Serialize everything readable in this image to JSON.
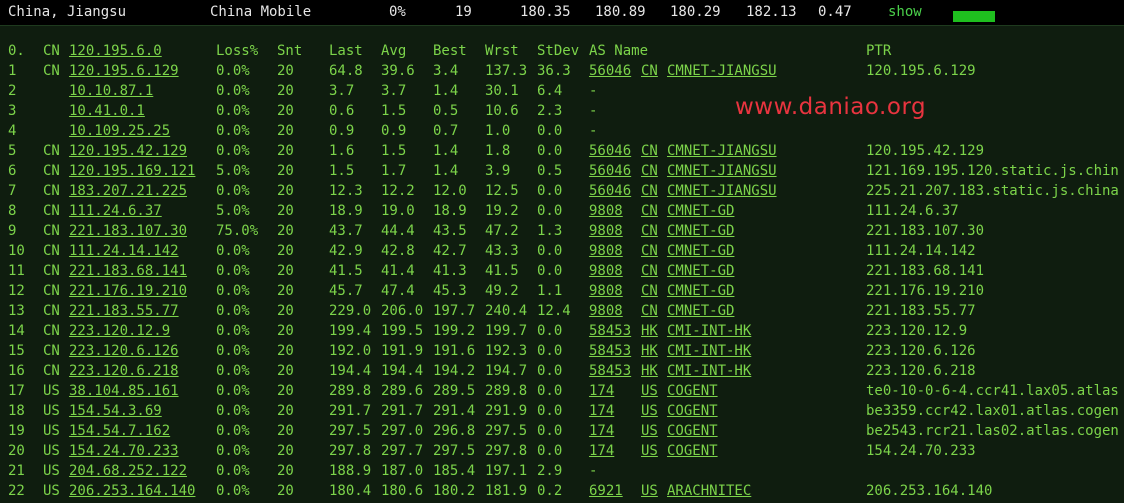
{
  "summary": {
    "location": "China, Jiangsu",
    "isp": "China Mobile",
    "loss": "0%",
    "sent": "19",
    "last": "180.35",
    "avg": "180.89",
    "best": "180.29",
    "worst": "182.13",
    "stdev": "0.47",
    "show_label": "show",
    "bar_color": "#1fbf1f"
  },
  "watermark": "www.daniao.org",
  "columns": {
    "hop": "0.",
    "cc": "CN",
    "ip": "120.195.6.0",
    "loss": "Loss%",
    "snt": "Snt",
    "last": "Last",
    "avg": "Avg",
    "best": "Best",
    "wrst": "Wrst",
    "stdev": "StDev",
    "asname": "AS Name",
    "ptr": "PTR"
  },
  "rows": [
    {
      "hop": "1",
      "cc": "CN",
      "ip": "120.195.6.129",
      "loss": "0.0%",
      "snt": "20",
      "last": "64.8",
      "avg": "39.6",
      "best": "3.4",
      "wrst": "137.3",
      "stdev": "36.3",
      "asn": "56046",
      "ascc": "CN",
      "asname": "CMNET-JIANGSU",
      "ptr": "120.195.6.129"
    },
    {
      "hop": "2",
      "cc": "",
      "ip": "10.10.87.1",
      "loss": "0.0%",
      "snt": "20",
      "last": "3.7",
      "avg": "3.7",
      "best": "1.4",
      "wrst": "30.1",
      "stdev": "6.4",
      "asn": "-",
      "ascc": "",
      "asname": "",
      "ptr": ""
    },
    {
      "hop": "3",
      "cc": "",
      "ip": "10.41.0.1",
      "loss": "0.0%",
      "snt": "20",
      "last": "0.6",
      "avg": "1.5",
      "best": "0.5",
      "wrst": "10.6",
      "stdev": "2.3",
      "asn": "-",
      "ascc": "",
      "asname": "",
      "ptr": ""
    },
    {
      "hop": "4",
      "cc": "",
      "ip": "10.109.25.25",
      "loss": "0.0%",
      "snt": "20",
      "last": "0.9",
      "avg": "0.9",
      "best": "0.7",
      "wrst": "1.0",
      "stdev": "0.0",
      "asn": "-",
      "ascc": "",
      "asname": "",
      "ptr": ""
    },
    {
      "hop": "5",
      "cc": "CN",
      "ip": "120.195.42.129",
      "loss": "0.0%",
      "snt": "20",
      "last": "1.6",
      "avg": "1.5",
      "best": "1.4",
      "wrst": "1.8",
      "stdev": "0.0",
      "asn": "56046",
      "ascc": "CN",
      "asname": "CMNET-JIANGSU",
      "ptr": "120.195.42.129"
    },
    {
      "hop": "6",
      "cc": "CN",
      "ip": "120.195.169.121",
      "loss": "5.0%",
      "snt": "20",
      "last": "1.5",
      "avg": "1.7",
      "best": "1.4",
      "wrst": "3.9",
      "stdev": "0.5",
      "asn": "56046",
      "ascc": "CN",
      "asname": "CMNET-JIANGSU",
      "ptr": "121.169.195.120.static.js.chin"
    },
    {
      "hop": "7",
      "cc": "CN",
      "ip": "183.207.21.225",
      "loss": "0.0%",
      "snt": "20",
      "last": "12.3",
      "avg": "12.2",
      "best": "12.0",
      "wrst": "12.5",
      "stdev": "0.0",
      "asn": "56046",
      "ascc": "CN",
      "asname": "CMNET-JIANGSU",
      "ptr": "225.21.207.183.static.js.china"
    },
    {
      "hop": "8",
      "cc": "CN",
      "ip": "111.24.6.37",
      "loss": "5.0%",
      "snt": "20",
      "last": "18.9",
      "avg": "19.0",
      "best": "18.9",
      "wrst": "19.2",
      "stdev": "0.0",
      "asn": "9808",
      "ascc": "CN",
      "asname": "CMNET-GD",
      "ptr": "111.24.6.37"
    },
    {
      "hop": "9",
      "cc": "CN",
      "ip": "221.183.107.30",
      "loss": "75.0%",
      "snt": "20",
      "last": "43.7",
      "avg": "44.4",
      "best": "43.5",
      "wrst": "47.2",
      "stdev": "1.3",
      "asn": "9808",
      "ascc": "CN",
      "asname": "CMNET-GD",
      "ptr": "221.183.107.30"
    },
    {
      "hop": "10",
      "cc": "CN",
      "ip": "111.24.14.142",
      "loss": "0.0%",
      "snt": "20",
      "last": "42.9",
      "avg": "42.8",
      "best": "42.7",
      "wrst": "43.3",
      "stdev": "0.0",
      "asn": "9808",
      "ascc": "CN",
      "asname": "CMNET-GD",
      "ptr": "111.24.14.142"
    },
    {
      "hop": "11",
      "cc": "CN",
      "ip": "221.183.68.141",
      "loss": "0.0%",
      "snt": "20",
      "last": "41.5",
      "avg": "41.4",
      "best": "41.3",
      "wrst": "41.5",
      "stdev": "0.0",
      "asn": "9808",
      "ascc": "CN",
      "asname": "CMNET-GD",
      "ptr": "221.183.68.141"
    },
    {
      "hop": "12",
      "cc": "CN",
      "ip": "221.176.19.210",
      "loss": "0.0%",
      "snt": "20",
      "last": "45.7",
      "avg": "47.4",
      "best": "45.3",
      "wrst": "49.2",
      "stdev": "1.1",
      "asn": "9808",
      "ascc": "CN",
      "asname": "CMNET-GD",
      "ptr": "221.176.19.210"
    },
    {
      "hop": "13",
      "cc": "CN",
      "ip": "221.183.55.77",
      "loss": "0.0%",
      "snt": "20",
      "last": "229.0",
      "avg": "206.0",
      "best": "197.7",
      "wrst": "240.4",
      "stdev": "12.4",
      "asn": "9808",
      "ascc": "CN",
      "asname": "CMNET-GD",
      "ptr": "221.183.55.77"
    },
    {
      "hop": "14",
      "cc": "CN",
      "ip": "223.120.12.9",
      "loss": "0.0%",
      "snt": "20",
      "last": "199.4",
      "avg": "199.5",
      "best": "199.2",
      "wrst": "199.7",
      "stdev": "0.0",
      "asn": "58453",
      "ascc": "HK",
      "asname": "CMI-INT-HK",
      "ptr": "223.120.12.9"
    },
    {
      "hop": "15",
      "cc": "CN",
      "ip": "223.120.6.126",
      "loss": "0.0%",
      "snt": "20",
      "last": "192.0",
      "avg": "191.9",
      "best": "191.6",
      "wrst": "192.3",
      "stdev": "0.0",
      "asn": "58453",
      "ascc": "HK",
      "asname": "CMI-INT-HK",
      "ptr": "223.120.6.126"
    },
    {
      "hop": "16",
      "cc": "CN",
      "ip": "223.120.6.218",
      "loss": "0.0%",
      "snt": "20",
      "last": "194.4",
      "avg": "194.4",
      "best": "194.2",
      "wrst": "194.7",
      "stdev": "0.0",
      "asn": "58453",
      "ascc": "HK",
      "asname": "CMI-INT-HK",
      "ptr": "223.120.6.218"
    },
    {
      "hop": "17",
      "cc": "US",
      "ip": "38.104.85.161",
      "loss": "0.0%",
      "snt": "20",
      "last": "289.8",
      "avg": "289.6",
      "best": "289.5",
      "wrst": "289.8",
      "stdev": "0.0",
      "asn": "174",
      "ascc": "US",
      "asname": "COGENT",
      "ptr": "te0-10-0-6-4.ccr41.lax05.atlas"
    },
    {
      "hop": "18",
      "cc": "US",
      "ip": "154.54.3.69",
      "loss": "0.0%",
      "snt": "20",
      "last": "291.7",
      "avg": "291.7",
      "best": "291.4",
      "wrst": "291.9",
      "stdev": "0.0",
      "asn": "174",
      "ascc": "US",
      "asname": "COGENT",
      "ptr": "be3359.ccr42.lax01.atlas.cogen"
    },
    {
      "hop": "19",
      "cc": "US",
      "ip": "154.54.7.162",
      "loss": "0.0%",
      "snt": "20",
      "last": "297.5",
      "avg": "297.0",
      "best": "296.8",
      "wrst": "297.5",
      "stdev": "0.0",
      "asn": "174",
      "ascc": "US",
      "asname": "COGENT",
      "ptr": "be2543.rcr21.las02.atlas.cogen"
    },
    {
      "hop": "20",
      "cc": "US",
      "ip": "154.24.70.233",
      "loss": "0.0%",
      "snt": "20",
      "last": "297.8",
      "avg": "297.7",
      "best": "297.5",
      "wrst": "297.8",
      "stdev": "0.0",
      "asn": "174",
      "ascc": "US",
      "asname": "COGENT",
      "ptr": "154.24.70.233"
    },
    {
      "hop": "21",
      "cc": "US",
      "ip": "204.68.252.122",
      "loss": "0.0%",
      "snt": "20",
      "last": "188.9",
      "avg": "187.0",
      "best": "185.4",
      "wrst": "197.1",
      "stdev": "2.9",
      "asn": "-",
      "ascc": "",
      "asname": "",
      "ptr": ""
    },
    {
      "hop": "22",
      "cc": "US",
      "ip": "206.253.164.140",
      "loss": "0.0%",
      "snt": "20",
      "last": "180.4",
      "avg": "180.6",
      "best": "180.2",
      "wrst": "181.9",
      "stdev": "0.2",
      "asn": "6921",
      "ascc": "US",
      "asname": "ARACHNITEC",
      "ptr": "206.253.164.140"
    }
  ]
}
